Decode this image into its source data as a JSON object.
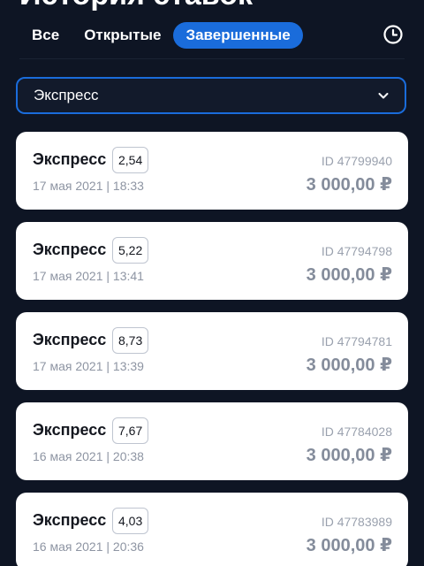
{
  "header": {
    "title": "История ставок"
  },
  "tabs": [
    {
      "label": "Все",
      "active": false
    },
    {
      "label": "Открытые",
      "active": false
    },
    {
      "label": "Завершенные",
      "active": true
    }
  ],
  "history_icon": "clock-icon",
  "filter": {
    "selected": "Экспресс",
    "icon": "chevron-down-icon"
  },
  "colors": {
    "background": "#0e1524",
    "accent": "#1a6cdb",
    "card": "#ffffff"
  },
  "bets": [
    {
      "type": "Экспресс",
      "coefficient": "2,54",
      "date": "17 мая 2021 | 18:33",
      "id": "ID 47799940",
      "amount": "3 000,00 ₽"
    },
    {
      "type": "Экспресс",
      "coefficient": "5,22",
      "date": "17 мая 2021 | 13:41",
      "id": "ID 47794798",
      "amount": "3 000,00 ₽"
    },
    {
      "type": "Экспресс",
      "coefficient": "8,73",
      "date": "17 мая 2021 | 13:39",
      "id": "ID 47794781",
      "amount": "3 000,00 ₽"
    },
    {
      "type": "Экспресс",
      "coefficient": "7,67",
      "date": "16 мая 2021 | 20:38",
      "id": "ID 47784028",
      "amount": "3 000,00 ₽"
    },
    {
      "type": "Экспресс",
      "coefficient": "4,03",
      "date": "16 мая 2021 | 20:36",
      "id": "ID 47783989",
      "amount": "3 000,00 ₽"
    }
  ]
}
